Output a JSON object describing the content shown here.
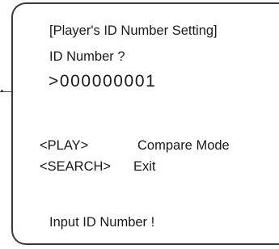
{
  "screen": {
    "title": "[Player's ID Number Setting]",
    "prompt": "ID Number ?",
    "cursor": ">",
    "id_value": "000000001",
    "options": [
      {
        "key": "<PLAY>",
        "action": "Compare Mode"
      },
      {
        "key": "<SEARCH>",
        "action": "Exit"
      }
    ],
    "status": "Input ID Number !"
  }
}
